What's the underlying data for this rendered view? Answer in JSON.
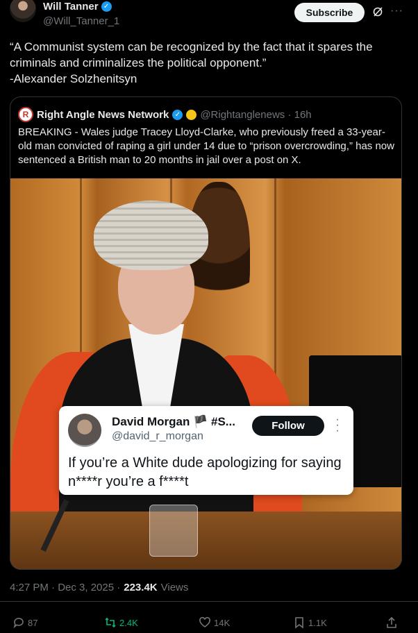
{
  "post": {
    "author_name": "Will Tanner",
    "author_handle": "@Will_Tanner_1",
    "subscribe_label": "Subscribe",
    "text": "“A Communist system can be recognized by the fact that it spares the criminals and criminalizes the political opponent.”\n-Alexander Solzhenitsyn",
    "timestamp": "4:27 PM · Dec 3, 2025 ·",
    "views_count": "223.4K",
    "views_label": "Views"
  },
  "quoted": {
    "author_name": "Right Angle News Network",
    "avatar_letter": "R",
    "handle_time": "@Rightanglenews · 16h",
    "text": "BREAKING - Wales judge Tracey Lloyd-Clarke, who previously freed a 33-year-old man convicted of raping a girl under 14 due to “prison overcrowding,” has now sentenced a British man to 20 months in jail over a post on X."
  },
  "embedded": {
    "author_name": "David Morgan 🏴 #S...",
    "author_handle": "@david_r_morgan",
    "follow_label": "Follow",
    "text": "If you’re a White dude apologizing for saying n****r you’re a f****t"
  },
  "actions": {
    "replies": "87",
    "reposts": "2.4K",
    "likes": "14K",
    "bookmarks": "1.1K"
  },
  "colors": {
    "background": "#000000",
    "accent": "#1d9bf0",
    "repost": "#00ba7c",
    "muted": "#71767b"
  }
}
